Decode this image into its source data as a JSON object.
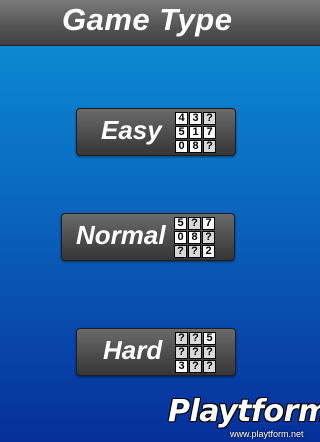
{
  "title": "Game Type",
  "buttons": [
    {
      "label": "Easy",
      "grid": [
        "4",
        "3",
        "?",
        "5",
        "1",
        "7",
        "0",
        "8",
        "?"
      ]
    },
    {
      "label": "Normal",
      "grid": [
        "5",
        "?",
        "7",
        "0",
        "8",
        "?",
        "?",
        "?",
        "2"
      ]
    },
    {
      "label": "Hard",
      "grid": [
        "?",
        "?",
        "5",
        "?",
        "?",
        "?",
        "3",
        "?",
        "?"
      ]
    }
  ],
  "logo": {
    "text": "Playtform",
    "url": "www.playtform.net"
  }
}
